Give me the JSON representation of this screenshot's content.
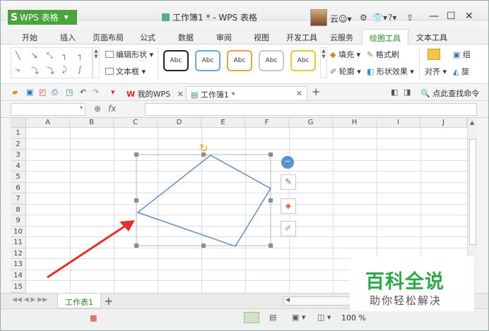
{
  "app": {
    "button_label": "WPS 表格",
    "logo": "S",
    "title": "工作簿1 * - WPS 表格",
    "cloud_label": "云"
  },
  "menu_tabs": [
    "开始",
    "插入",
    "页面布局",
    "公式",
    "数据",
    "审阅",
    "视图",
    "开发工具",
    "云服务",
    "绘图工具",
    "文本工具"
  ],
  "ribbon": {
    "edit_shape": "编辑形状",
    "text_box": "文本框",
    "style_label": "Abc",
    "fill": "填充",
    "format_painter": "格式刷",
    "outline": "轮廓",
    "shape_effects": "形状效果",
    "align": "对齐",
    "group": "组",
    "rotate": "旋"
  },
  "quickbar": {
    "tab_mywps": "我的WPS",
    "tab_workbook": "工作簿1 *",
    "search_command": "点此查找命令"
  },
  "formula": {
    "fx": "fx",
    "value": ""
  },
  "columns": [
    "A",
    "B",
    "C",
    "D",
    "E",
    "F",
    "G",
    "H",
    "I",
    "J"
  ],
  "rows": [
    "1",
    "2",
    "3",
    "4",
    "5",
    "6",
    "7",
    "8",
    "9",
    "10",
    "11",
    "12",
    "13",
    "14",
    "15"
  ],
  "sheet_tab": "工作表1",
  "zoom": "100 %",
  "watermark": {
    "title": "百科全说",
    "subtitle": "助你轻松解决"
  },
  "colors": {
    "accent": "#4aa33b",
    "shape_stroke": "#4f7fb5",
    "arrow": "#e0332f"
  }
}
